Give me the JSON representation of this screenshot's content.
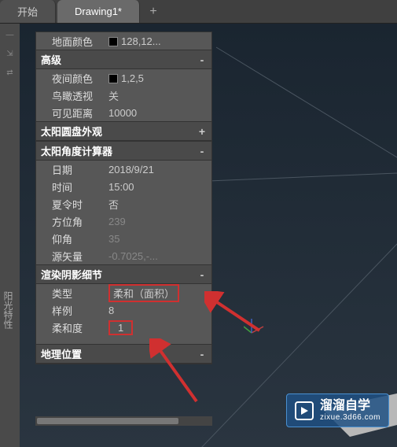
{
  "tabs": {
    "start": "开始",
    "drawing": "Drawing1*",
    "add": "+"
  },
  "side_panel_label": "阳光特性",
  "sections": {
    "ground_color": {
      "label": "地面颜色",
      "value": "128,12..."
    },
    "advanced": {
      "title": "高级",
      "toggle": "-"
    },
    "night_color": {
      "label": "夜间颜色",
      "value": "1,2,5"
    },
    "birds_eye": {
      "label": "鸟瞰透视",
      "value": "关"
    },
    "visible_distance": {
      "label": "可见距离",
      "value": "10000"
    },
    "sun_disk": {
      "title": "太阳圆盘外观",
      "toggle": "+"
    },
    "sun_angle": {
      "title": "太阳角度计算器",
      "toggle": "-"
    },
    "date": {
      "label": "日期",
      "value": "2018/9/21"
    },
    "time": {
      "label": "时间",
      "value": "15:00"
    },
    "dst": {
      "label": "夏令时",
      "value": "否"
    },
    "azimuth": {
      "label": "方位角",
      "value": "239"
    },
    "elevation": {
      "label": "仰角",
      "value": "35"
    },
    "source_vector": {
      "label": "源矢量",
      "value": "-0.7025,-..."
    },
    "shadow": {
      "title": "渲染阴影细节",
      "toggle": "-"
    },
    "type": {
      "label": "类型",
      "value": "柔和（面积）"
    },
    "samples": {
      "label": "样例",
      "value": "8"
    },
    "softness": {
      "label": "柔和度",
      "value": "1"
    },
    "geo": {
      "title": "地理位置",
      "toggle": "-"
    }
  },
  "watermark": {
    "title": "溜溜自学",
    "url": "zixue.3d66.com"
  }
}
